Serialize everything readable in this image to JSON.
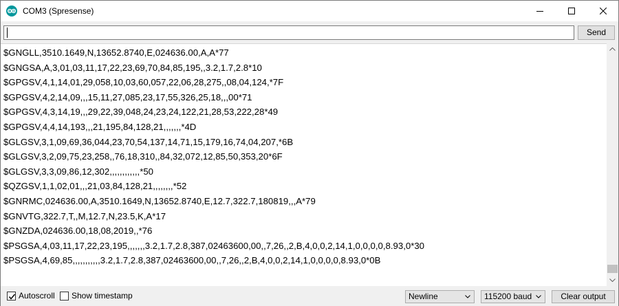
{
  "window": {
    "title": "COM3 (Spresense)",
    "app_icon": "arduino-icon",
    "controls": [
      "minimize-icon",
      "maximize-icon",
      "close-icon"
    ]
  },
  "send_bar": {
    "input_value": "",
    "send_label": "Send"
  },
  "serial_output": {
    "lines": [
      "$GNGLL,3510.1649,N,13652.8740,E,024636.00,A,A*77",
      "$GNGSA,A,3,01,03,11,17,22,23,69,70,84,85,195,,3.2,1.7,2.8*10",
      "$GPGSV,4,1,14,01,29,058,10,03,60,057,22,06,28,275,,08,04,124,*7F",
      "$GPGSV,4,2,14,09,,,15,11,27,085,23,17,55,326,25,18,,,00*71",
      "$GPGSV,4,3,14,19,,,29,22,39,048,24,23,24,122,21,28,53,222,28*49",
      "$GPGSV,4,4,14,193,,,21,195,84,128,21,,,,,,,*4D",
      "$GLGSV,3,1,09,69,36,044,23,70,54,137,14,71,15,179,16,74,04,207,*6B",
      "$GLGSV,3,2,09,75,23,258,,76,18,310,,84,32,072,12,85,50,353,20*6F",
      "$GLGSV,3,3,09,86,12,302,,,,,,,,,,,,*50",
      "$QZGSV,1,1,02,01,,,21,03,84,128,21,,,,,,,,*52",
      "$GNRMC,024636.00,A,3510.1649,N,13652.8740,E,12.7,322.7,180819,,,A*79",
      "$GNVTG,322.7,T,,M,12.7,N,23.5,K,A*17",
      "$GNZDA,024636.00,18,08,2019,,*76",
      "$PSGSA,4,03,11,17,22,23,195,,,,,,,3.2,1.7,2.8,387,02463600,00,,7,26,,2,B,4,0,0,2,14,1,0,0,0,0,8.93,0*30",
      "$PSGSA,4,69,85,,,,,,,,,,,3.2,1.7,2.8,387,02463600,00,,7,26,,2,B,4,0,0,2,14,1,0,0,0,0,8.93,0*0B"
    ]
  },
  "status_bar": {
    "autoscroll": {
      "label": "Autoscroll",
      "checked": true
    },
    "show_timestamp": {
      "label": "Show timestamp",
      "checked": false
    },
    "line_ending": {
      "selected": "Newline"
    },
    "baud_rate": {
      "selected": "115200 baud"
    },
    "clear_label": "Clear output"
  },
  "colors": {
    "arduino_teal": "#00979c",
    "window_bg": "#f0f0f0",
    "output_bg": "#ffffff",
    "button_bg": "#e1e1e1"
  }
}
